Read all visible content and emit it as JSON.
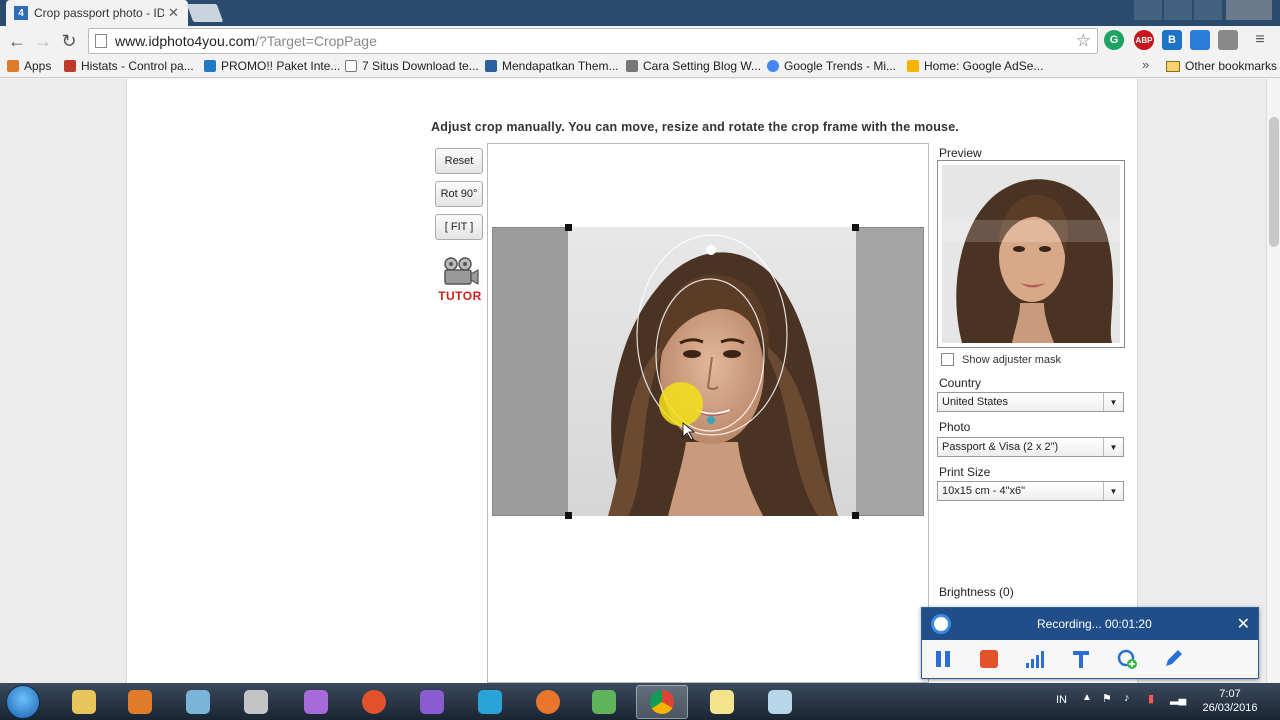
{
  "browser": {
    "tab_title": "Crop passport photo - IDP",
    "tab_favicon": "4",
    "url_host": "www.idphoto4you.com",
    "url_path": "/?Target=CropPage",
    "extension_abp_label": "ABP",
    "extension_b_label": "B"
  },
  "bookmarks": {
    "items": [
      {
        "label": "Apps",
        "icon": "apps-grid-icon",
        "color": "#e07b2a"
      },
      {
        "label": "Histats - Control pa...",
        "icon": "histats-icon",
        "color": "#c0392b"
      },
      {
        "label": "PROMO!! Paket Inte...",
        "icon": "promo-icon",
        "color": "#1f78c8"
      },
      {
        "label": "7 Situs Download te...",
        "icon": "page-icon",
        "color": "#ffffff"
      },
      {
        "label": "Mendapatkan Them...",
        "icon": "r-icon",
        "color": "#2c5fa0"
      },
      {
        "label": "Cara Setting Blog W...",
        "icon": "pin-icon",
        "color": "#777777"
      },
      {
        "label": "Google Trends - Mi...",
        "icon": "google-icon",
        "color": "#4285f4"
      },
      {
        "label": "Home: Google AdSe...",
        "icon": "adsense-icon",
        "color": "#f4b400"
      }
    ],
    "more": "»",
    "other": "Other bookmarks"
  },
  "page": {
    "instructions": "Adjust crop manually. You can move, resize and rotate the crop frame with the mouse.",
    "buttons": {
      "reset": "Reset",
      "rotate": "Rot 90°",
      "fit": "[ FIT ]"
    },
    "tutor": "TUTOR",
    "preview_label": "Preview",
    "adjuster_mask": "Show adjuster mask",
    "country_label": "Country",
    "country_value": "United States",
    "photo_label": "Photo",
    "photo_value": "Passport & Visa (2 x 2\")",
    "print_label": "Print Size",
    "print_value": "10x15 cm - 4\"x6\"",
    "brightness_label": "Brightness (0)"
  },
  "recorder": {
    "status": "Recording... 00:01:20",
    "close": "✕"
  },
  "taskbar": {
    "language": "IN",
    "time": "7:07",
    "date": "26/03/2016"
  },
  "colors": {
    "accent": "#1f4e89",
    "tutor_red": "#d21f1f",
    "record_stop": "#e2522b",
    "cursor_highlight": "#f3e01a"
  }
}
